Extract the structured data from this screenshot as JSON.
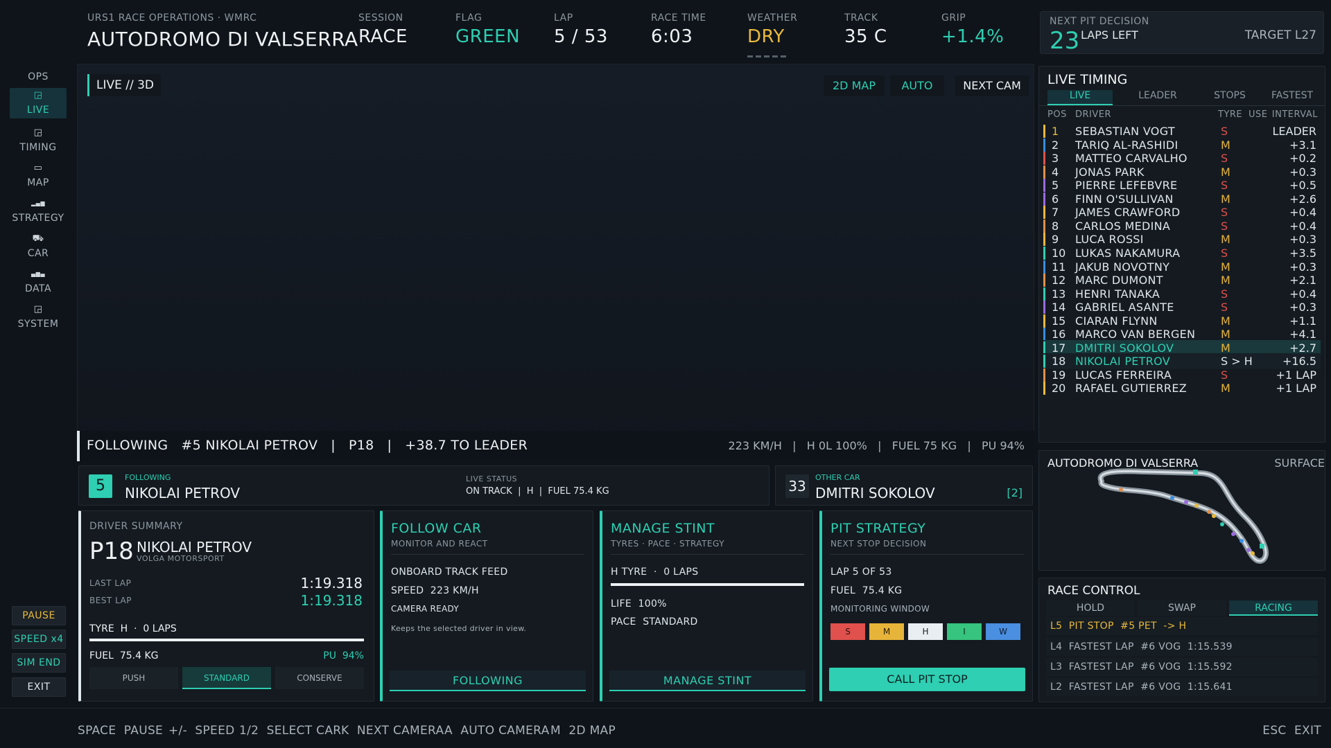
{
  "header": {
    "org": "URS1 RACE OPERATIONS · WMRC",
    "track": "AUTODROMO DI VALSERRA",
    "stats": [
      {
        "label": "SESSION",
        "value": "RACE",
        "color": "#eef2f5"
      },
      {
        "label": "FLAG",
        "value": "GREEN",
        "color": "#2ecfb2"
      },
      {
        "label": "LAP",
        "value": "5 / 53",
        "color": "#eef2f5"
      },
      {
        "label": "RACE TIME",
        "value": "6:03",
        "color": "#eef2f5"
      },
      {
        "label": "WEATHER",
        "value": "DRY",
        "color": "#e9b93a"
      },
      {
        "label": "TRACK",
        "value": "35 C",
        "color": "#eef2f5"
      },
      {
        "label": "GRIP",
        "value": "+1.4%",
        "color": "#2ecfb2"
      }
    ],
    "next_pit": {
      "label": "NEXT PIT DECISION",
      "laps": "23",
      "laps_label": "LAPS LEFT",
      "target": "TARGET L27"
    }
  },
  "rail": {
    "items": [
      {
        "label": "OPS",
        "icon": "ops-icon",
        "glyph": ""
      },
      {
        "label": "LIVE",
        "icon": "live-icon",
        "glyph": "◲"
      },
      {
        "label": "TIMING",
        "icon": "timing-icon",
        "glyph": "◲"
      },
      {
        "label": "MAP",
        "icon": "map-icon",
        "glyph": "▭"
      },
      {
        "label": "STRATEGY",
        "icon": "strategy-icon",
        "glyph": "▂▄▆"
      },
      {
        "label": "CAR",
        "icon": "car-icon",
        "glyph": "⛟"
      },
      {
        "label": "DATA",
        "icon": "data-icon",
        "glyph": "▄▆▄"
      },
      {
        "label": "SYSTEM",
        "icon": "system-icon",
        "glyph": "◲"
      }
    ],
    "controls": [
      "PAUSE",
      "SPEED x4",
      "SIM END",
      "EXIT"
    ]
  },
  "viewport": {
    "badge": "LIVE // 3D",
    "buttons": [
      "2D MAP",
      "AUTO",
      "NEXT CAM"
    ],
    "following_line": "FOLLOWING   #5 NIKOLAI PETROV   |   P18   |   +38.7 TO LEADER",
    "telemetry": "223 KM/H   |   H 0L 100%   |   FUEL 75 KG   |   PU 94%"
  },
  "cards": {
    "following": {
      "number": "5",
      "tag": "FOLLOWING",
      "name": "NIKOLAI PETROV",
      "status_label": "LIVE STATUS",
      "status": "ON TRACK  |  H  |  FUEL 75.4 KG"
    },
    "other": {
      "number": "33",
      "tag": "OTHER CAR",
      "name": "DMITRI SOKOLOV",
      "key": "[2]"
    }
  },
  "summary": {
    "title": "DRIVER SUMMARY",
    "pos": "P18",
    "name": "NIKOLAI PETROV",
    "team": "VOLGA MOTORSPORT",
    "last_label": "LAST LAP",
    "last": "1:19.318",
    "best_label": "BEST LAP",
    "best": "1:19.318",
    "tyre": "TYRE  H  ·  0 LAPS",
    "tyre_life": 1.0,
    "fuel": "FUEL  75.4 KG",
    "pu": "PU  94%",
    "modes": [
      "PUSH",
      "STANDARD",
      "CONSERVE"
    ]
  },
  "follow_car": {
    "title": "FOLLOW CAR",
    "sub": "MONITOR AND REACT",
    "l1": "ONBOARD TRACK FEED",
    "l2": "SPEED  223 KM/H",
    "l3": "CAMERA READY",
    "note": "Keeps the selected driver in view.",
    "button": "FOLLOWING"
  },
  "stint": {
    "title": "MANAGE STINT",
    "sub": "TYRES · PACE · STRATEGY",
    "tyre": "H TYRE  ·  0 LAPS",
    "tyre_life": 1.0,
    "life": "LIFE  100%",
    "pace": "PACE  STANDARD",
    "button": "MANAGE STINT"
  },
  "pit": {
    "title": "PIT STRATEGY",
    "sub": "NEXT STOP DECISION",
    "lap": "LAP 5 OF 53",
    "fuel": "FUEL  75.4 KG",
    "window": "MONITORING WINDOW",
    "compounds": [
      {
        "label": "S",
        "bg": "#e0514d",
        "fg": "#2a0d0c"
      },
      {
        "label": "M",
        "bg": "#e7b43a",
        "fg": "#2a2008"
      },
      {
        "label": "H",
        "bg": "#e9eef2",
        "fg": "#1a1f24"
      },
      {
        "label": "I",
        "bg": "#36c47e",
        "fg": "#0b2a1a"
      },
      {
        "label": "W",
        "bg": "#4a8fe0",
        "fg": "#0b1a2d"
      }
    ],
    "button": "CALL PIT STOP"
  },
  "timing": {
    "title": "LIVE TIMING",
    "tabs": [
      "LIVE",
      "LEADER",
      "STOPS",
      "FASTEST"
    ],
    "cols": [
      "POS",
      "DRIVER",
      "TYRE",
      "USE",
      "INTERVAL"
    ],
    "rows": [
      {
        "pos": "1",
        "driver": "SEBASTIAN VOGT",
        "tyre": "S",
        "gap": "LEADER",
        "team": "#e9b93a"
      },
      {
        "pos": "2",
        "driver": "TARIQ AL-RASHIDI",
        "tyre": "M",
        "gap": "+3.1",
        "team": "#3a8ee0"
      },
      {
        "pos": "3",
        "driver": "MATTEO CARVALHO",
        "tyre": "S",
        "gap": "+0.2",
        "team": "#e0514d"
      },
      {
        "pos": "4",
        "driver": "JONAS PARK",
        "tyre": "M",
        "gap": "+0.3",
        "team": "#e0904d"
      },
      {
        "pos": "5",
        "driver": "PIERRE LEFEBVRE",
        "tyre": "S",
        "gap": "+0.5",
        "team": "#9b6be0"
      },
      {
        "pos": "6",
        "driver": "FINN O'SULLIVAN",
        "tyre": "M",
        "gap": "+2.6",
        "team": "#9b6be0"
      },
      {
        "pos": "7",
        "driver": "JAMES CRAWFORD",
        "tyre": "S",
        "gap": "+0.4",
        "team": "#e9b93a"
      },
      {
        "pos": "8",
        "driver": "CARLOS MEDINA",
        "tyre": "S",
        "gap": "+0.4",
        "team": "#e0904d"
      },
      {
        "pos": "9",
        "driver": "LUCA ROSSI",
        "tyre": "M",
        "gap": "+0.3",
        "team": "#e9b93a"
      },
      {
        "pos": "10",
        "driver": "LUKAS NAKAMURA",
        "tyre": "S",
        "gap": "+3.5",
        "team": "#2ecfb2"
      },
      {
        "pos": "11",
        "driver": "JAKUB NOVOTNY",
        "tyre": "M",
        "gap": "+0.3",
        "team": "#3a8ee0"
      },
      {
        "pos": "12",
        "driver": "MARC DUMONT",
        "tyre": "M",
        "gap": "+2.1",
        "team": "#e0904d"
      },
      {
        "pos": "13",
        "driver": "HENRI TANAKA",
        "tyre": "S",
        "gap": "+0.4",
        "team": "#2ecfb2"
      },
      {
        "pos": "14",
        "driver": "GABRIEL ASANTE",
        "tyre": "S",
        "gap": "+0.3",
        "team": "#9b6be0"
      },
      {
        "pos": "15",
        "driver": "CIARAN FLYNN",
        "tyre": "M",
        "gap": "+1.1",
        "team": "#e9b93a"
      },
      {
        "pos": "16",
        "driver": "MARCO VAN BERGEN",
        "tyre": "M",
        "gap": "+4.1",
        "team": "#3a8ee0"
      },
      {
        "pos": "17",
        "driver": "DMITRI SOKOLOV",
        "tyre": "M",
        "gap": "+2.7",
        "team": "#2ecfb2"
      },
      {
        "pos": "18",
        "driver": "NIKOLAI PETROV",
        "tyre": "S > H",
        "gap": "+16.5",
        "team": "#2ecfb2"
      },
      {
        "pos": "19",
        "driver": "LUCAS FERREIRA",
        "tyre": "S",
        "gap": "+1 LAP",
        "team": "#e0904d"
      },
      {
        "pos": "20",
        "driver": "RAFAEL GUTIERREZ",
        "tyre": "M",
        "gap": "+1 LAP",
        "team": "#e9b93a"
      }
    ]
  },
  "map": {
    "title": "AUTODROMO DI VALSERRA",
    "mode": "SURFACE"
  },
  "race_control": {
    "title": "RACE CONTROL",
    "tabs": [
      "HOLD",
      "SWAP",
      "RACING"
    ],
    "messages": [
      {
        "text": "L5  PIT STOP  #5 PET  -> H",
        "color": "#e9b93a"
      },
      {
        "text": "L4  FASTEST LAP  #6 VOG  1:15.539",
        "color": "#aab3bb"
      },
      {
        "text": "L3  FASTEST LAP  #6 VOG  1:15.592",
        "color": "#aab3bb"
      },
      {
        "text": "L2  FASTEST LAP  #6 VOG  1:15.641",
        "color": "#aab3bb"
      }
    ]
  },
  "shortcuts": [
    "SPACE  PAUSE",
    "+/-  SPEED",
    "1/2  SELECT CAR",
    "K  NEXT CAMERA",
    "A  AUTO CAMERA",
    "M  2D MAP"
  ],
  "exit_hint": "ESC  EXIT"
}
